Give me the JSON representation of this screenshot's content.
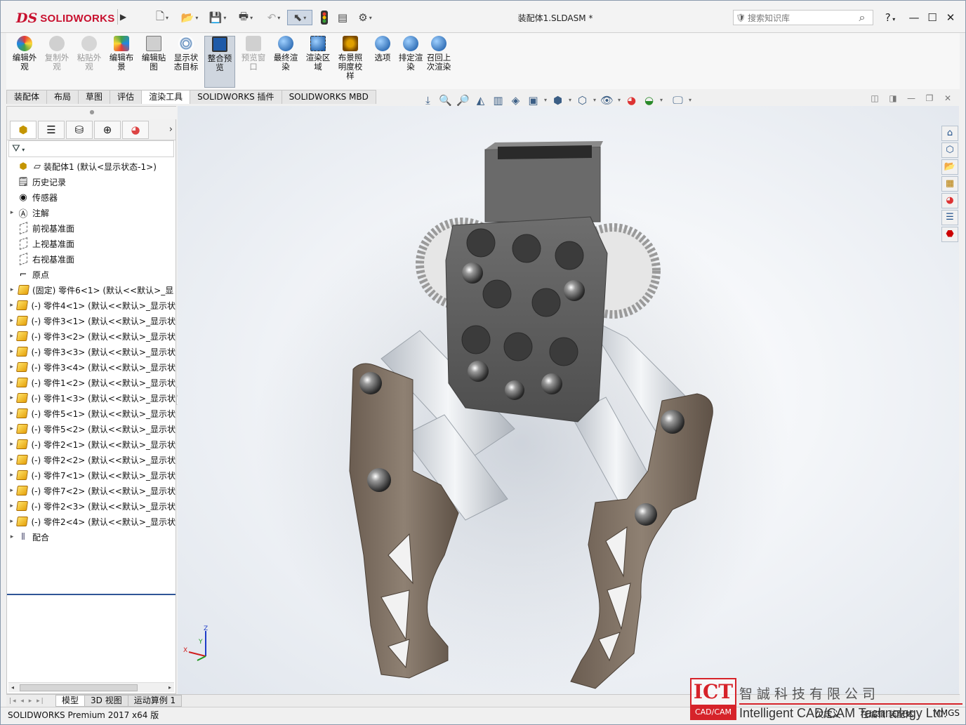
{
  "app": {
    "logo_ds": "DS",
    "logo_text": "SOLIDWORKS",
    "document_title": "装配体1.SLDASM *"
  },
  "search": {
    "placeholder": "搜索知识库"
  },
  "window_controls": {
    "help": "?",
    "minimize": "—",
    "maximize": "☐",
    "close": "✕"
  },
  "ribbon": {
    "buttons": [
      {
        "label": "编辑外观",
        "enabled": true
      },
      {
        "label": "复制外观",
        "enabled": false
      },
      {
        "label": "粘贴外观",
        "enabled": false
      },
      {
        "label": "编辑布景",
        "enabled": true
      },
      {
        "label": "编辑贴图",
        "enabled": true
      },
      {
        "label": "显示状态目标",
        "enabled": true
      },
      {
        "label": "整合预览",
        "enabled": true,
        "active": true
      },
      {
        "label": "预览窗口",
        "enabled": false
      },
      {
        "label": "最终渲染",
        "enabled": true
      },
      {
        "label": "渲染区域",
        "enabled": true
      },
      {
        "label": "布景照明度校样",
        "enabled": true
      },
      {
        "label": "选项",
        "enabled": true
      },
      {
        "label": "排定渲染",
        "enabled": true
      },
      {
        "label": "召回上次渲染",
        "enabled": true
      }
    ]
  },
  "command_tabs": [
    "装配体",
    "布局",
    "草图",
    "评估",
    "渲染工具",
    "SOLIDWORKS 插件",
    "SOLIDWORKS MBD"
  ],
  "command_tabs_active": "渲染工具",
  "tree": {
    "root": "装配体1  (默认<显示状态-1>)",
    "items": [
      {
        "label": "历史记录",
        "icon": "history-icon"
      },
      {
        "label": "传感器",
        "icon": "sensor-icon"
      },
      {
        "label": "注解",
        "icon": "annotation-icon",
        "expandable": true
      },
      {
        "label": "前视基准面",
        "icon": "plane-icon"
      },
      {
        "label": "上视基准面",
        "icon": "plane-icon"
      },
      {
        "label": "右视基准面",
        "icon": "plane-icon"
      },
      {
        "label": "原点",
        "icon": "origin-icon"
      },
      {
        "label": "(固定) 零件6<1> (默认<<默认>_显",
        "icon": "part-icon",
        "expandable": true
      },
      {
        "label": "(-) 零件4<1> (默认<<默认>_显示状",
        "icon": "part-icon",
        "expandable": true
      },
      {
        "label": "(-) 零件3<1> (默认<<默认>_显示状",
        "icon": "part-icon",
        "expandable": true
      },
      {
        "label": "(-) 零件3<2> (默认<<默认>_显示状",
        "icon": "part-icon",
        "expandable": true
      },
      {
        "label": "(-) 零件3<3> (默认<<默认>_显示状",
        "icon": "part-icon",
        "expandable": true
      },
      {
        "label": "(-) 零件3<4> (默认<<默认>_显示状",
        "icon": "part-icon",
        "expandable": true
      },
      {
        "label": "(-) 零件1<2> (默认<<默认>_显示状",
        "icon": "part-icon",
        "expandable": true
      },
      {
        "label": "(-) 零件1<3> (默认<<默认>_显示状",
        "icon": "part-icon",
        "expandable": true
      },
      {
        "label": "(-) 零件5<1> (默认<<默认>_显示状",
        "icon": "part-icon",
        "expandable": true
      },
      {
        "label": "(-) 零件5<2> (默认<<默认>_显示状",
        "icon": "part-icon",
        "expandable": true
      },
      {
        "label": "(-) 零件2<1> (默认<<默认>_显示状",
        "icon": "part-icon",
        "expandable": true
      },
      {
        "label": "(-) 零件2<2> (默认<<默认>_显示状",
        "icon": "part-icon",
        "expandable": true
      },
      {
        "label": "(-) 零件7<1> (默认<<默认>_显示状",
        "icon": "part-icon",
        "expandable": true
      },
      {
        "label": "(-) 零件7<2> (默认<<默认>_显示状",
        "icon": "part-icon",
        "expandable": true
      },
      {
        "label": "(-) 零件2<3> (默认<<默认>_显示状",
        "icon": "part-icon",
        "expandable": true
      },
      {
        "label": "(-) 零件2<4> (默认<<默认>_显示状",
        "icon": "part-icon",
        "expandable": true
      },
      {
        "label": "配合",
        "icon": "mates-icon",
        "expandable": true
      }
    ]
  },
  "triad": {
    "x": "X",
    "y": "Y",
    "z": "Z"
  },
  "bottom_tabs": [
    "模型",
    "3D 视图",
    "运动算例 1"
  ],
  "bottom_tabs_active": "模型",
  "status": {
    "left": "SOLIDWORKS Premium 2017 x64 版",
    "right_1": "欠定义",
    "right_2": "在编辑 装配体",
    "right_3": "MMGS"
  },
  "watermark": {
    "logo": "ICT",
    "logo_sub": "CAD/CAM",
    "name_cn": "智誠科技有限公司",
    "name_en": "Intelligent CAD/CAM Technology Ltd."
  },
  "colors": {
    "brand_red": "#c8102e",
    "tree_separator": "#2f5597",
    "metal_part": "#7d6f62",
    "gray_part": "#5f5f5f",
    "aluminium": "#d8dde3"
  }
}
